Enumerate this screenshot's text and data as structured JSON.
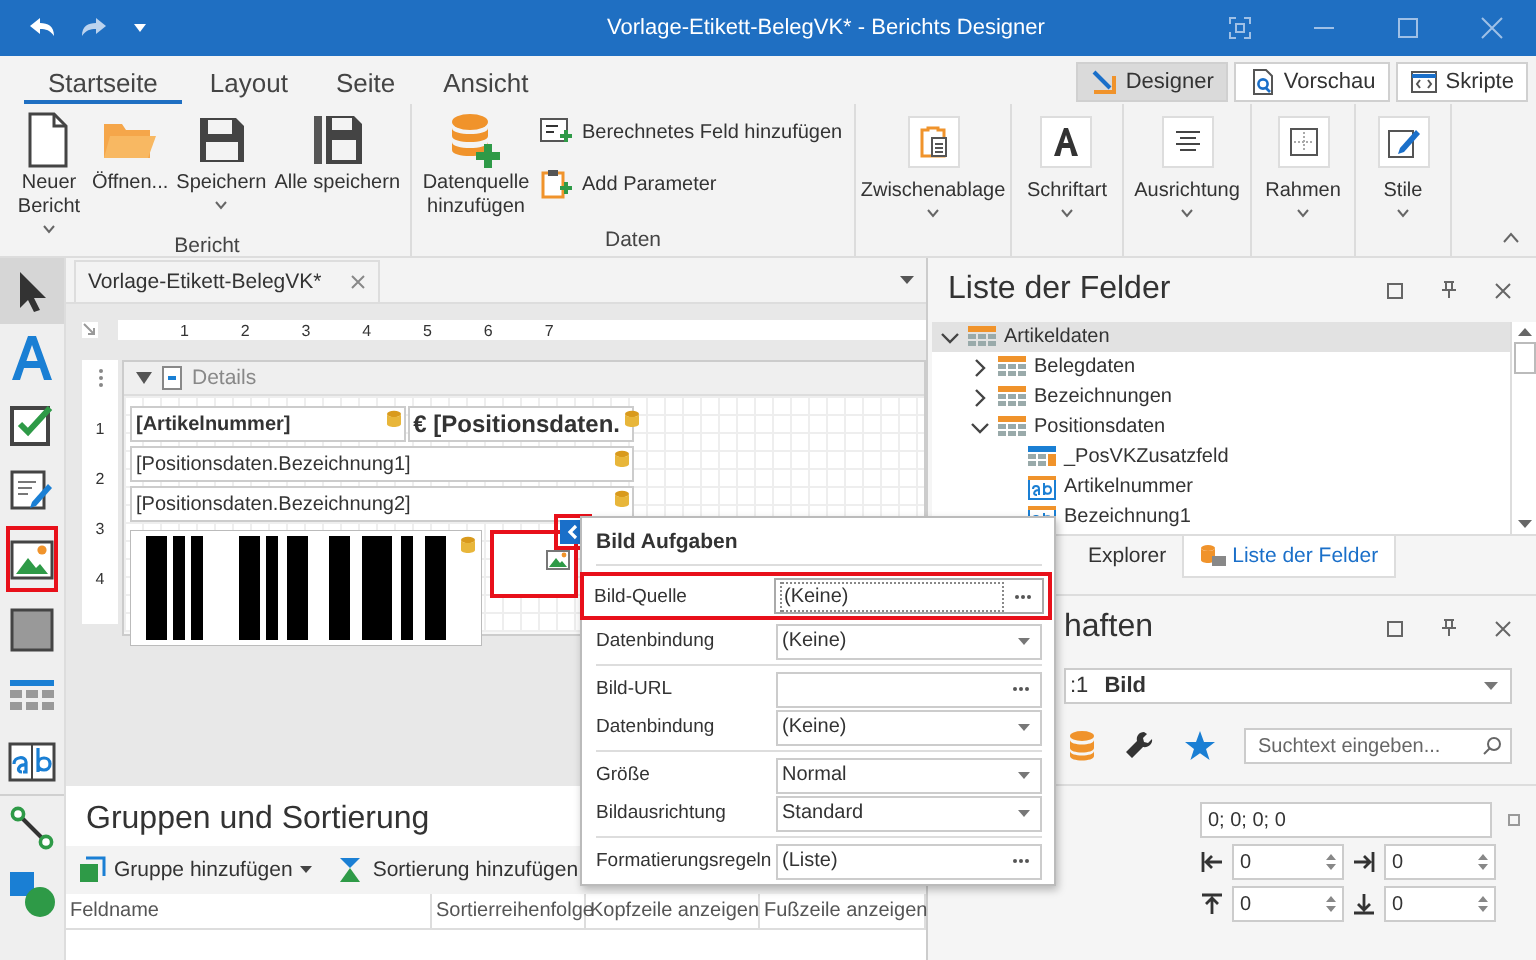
{
  "title_bar": {
    "title": "Vorlage-Etikett-BelegVK* - Berichts Designer"
  },
  "ribbon_tabs": [
    {
      "label": "Startseite",
      "selected": true
    },
    {
      "label": "Layout",
      "selected": false
    },
    {
      "label": "Seite",
      "selected": false
    },
    {
      "label": "Ansicht",
      "selected": false
    }
  ],
  "view_buttons": [
    {
      "label": "Designer",
      "selected": true
    },
    {
      "label": "Vorschau",
      "selected": false
    },
    {
      "label": "Skripte",
      "selected": false
    }
  ],
  "ribbon_groups": [
    {
      "label": "Bericht",
      "items": [
        {
          "kind": "large",
          "label": "Neuer Bericht",
          "dropdown": true
        },
        {
          "kind": "large",
          "label": "Öffnen...",
          "dropdown": false
        },
        {
          "kind": "large",
          "label": "Speichern",
          "dropdown": true
        },
        {
          "kind": "large",
          "label": "Alle speichern",
          "dropdown": false
        }
      ]
    },
    {
      "label": "Daten",
      "items": [
        {
          "kind": "large",
          "label": "Datenquelle hinzufügen",
          "dropdown": false
        },
        {
          "kind": "small",
          "label": "Berechnetes Feld hinzufügen",
          "dropdown": false
        },
        {
          "kind": "small",
          "label": "Add Parameter",
          "dropdown": false
        }
      ]
    },
    {
      "items": [
        {
          "kind": "boxed",
          "label": "Zwischenablage",
          "dropdown": true
        }
      ]
    },
    {
      "items": [
        {
          "kind": "boxed",
          "label": "Schriftart",
          "dropdown": true
        }
      ]
    },
    {
      "items": [
        {
          "kind": "boxed",
          "label": "Ausrichtung",
          "dropdown": true
        }
      ]
    },
    {
      "items": [
        {
          "kind": "boxed",
          "label": "Rahmen",
          "dropdown": true
        }
      ]
    },
    {
      "items": [
        {
          "kind": "boxed",
          "label": "Stile",
          "dropdown": true
        }
      ]
    }
  ],
  "toolbox": [
    {
      "selected": true,
      "highlighted": false
    },
    {
      "selected": false,
      "highlighted": false
    },
    {
      "selected": false,
      "highlighted": false
    },
    {
      "selected": false,
      "highlighted": false
    },
    {
      "selected": false,
      "highlighted": true
    },
    {
      "selected": false,
      "highlighted": false
    },
    {
      "selected": false,
      "highlighted": false
    },
    {
      "selected": false,
      "highlighted": false
    },
    {
      "selected": false,
      "highlighted": false
    },
    {
      "selected": false,
      "highlighted": false
    }
  ],
  "document_tab": {
    "title": "Vorlage-Etikett-BelegVK*"
  },
  "ruler": {
    "marks": [
      "1",
      "2",
      "3",
      "4",
      "5",
      "6",
      "7"
    ],
    "vertical_marks": [
      "1",
      "2",
      "3",
      "4"
    ]
  },
  "band": {
    "title": "Details",
    "expanded": true,
    "rows": [
      [
        {
          "text": "[Artikelnummer]",
          "bold": true,
          "kind": "normal"
        },
        {
          "text": "€ [Positionsdaten.",
          "bold": true,
          "kind": "large"
        }
      ],
      [
        {
          "text": "[Positionsdaten.Bezeichnung1]",
          "bold": false,
          "kind": "normal"
        }
      ],
      [
        {
          "text": "[Positionsdaten.Bezeichnung2]",
          "bold": false,
          "kind": "normal"
        }
      ]
    ],
    "picture_box": {
      "highlighted": true
    },
    "smart_tag": {
      "highlighted": true
    }
  },
  "groups_panel": {
    "title": "Gruppen und Sortierung",
    "buttons": [
      "Gruppe hinzufügen",
      "Sortierung hinzufügen"
    ],
    "columns": [
      "Feldname",
      "Sortierreihenfolge",
      "Kopfzeile anzeigen",
      "Fußzeile anzeigen"
    ]
  },
  "field_list": {
    "title": "Liste der Felder",
    "tree": [
      {
        "label": "Artikeldaten",
        "kind": "table",
        "expanded": true,
        "selected": true,
        "children": [
          {
            "label": "Belegdaten",
            "kind": "table",
            "expanded": false,
            "selected": false
          },
          {
            "label": "Bezeichnungen",
            "kind": "table",
            "expanded": false,
            "selected": false
          },
          {
            "label": "Positionsdaten",
            "kind": "table",
            "expanded": true,
            "selected": false,
            "children": [
              {
                "label": "_PosVKZusatzfeld",
                "kind": "subtable",
                "selected": false
              },
              {
                "label": "Artikelnummer",
                "kind": "text",
                "selected": false
              },
              {
                "label": "Bezeichnung1",
                "kind": "text",
                "selected": false
              }
            ]
          }
        ]
      }
    ],
    "tabs": [
      {
        "label": "Explorer",
        "selected": false
      },
      {
        "label": "Liste der Felder",
        "selected": true
      }
    ]
  },
  "properties": {
    "title": "haften",
    "selector": ":1",
    "selector_type": "Bild",
    "search": {
      "placeholder": "Suchtext eingeben..."
    },
    "padding": "0; 0; 0; 0",
    "spinners": [
      "0",
      "0",
      "0",
      "0"
    ]
  },
  "image_tasks": {
    "title": "Bild Aufgaben",
    "sections": [
      [
        {
          "label": "Bild-Quelle",
          "value": "(Keine)",
          "kind": "ellipsis",
          "highlighted": true
        },
        {
          "label": "Datenbindung",
          "value": "(Keine)",
          "kind": "dropdown",
          "highlighted": false
        }
      ],
      [
        {
          "label": "Bild-URL",
          "kind": "ellipsis",
          "highlighted": false
        },
        {
          "label": "Datenbindung",
          "value": "(Keine)",
          "kind": "dropdown",
          "highlighted": false
        }
      ],
      [
        {
          "label": "Größe",
          "value": "Normal",
          "kind": "dropdown",
          "highlighted": false
        },
        {
          "label": "Bildausrichtung",
          "value": "Standard",
          "kind": "dropdown",
          "highlighted": false
        }
      ],
      [
        {
          "label": "Formatierungsregeln",
          "value": "(Liste)",
          "kind": "ellipsis",
          "highlighted": false
        }
      ]
    ]
  }
}
